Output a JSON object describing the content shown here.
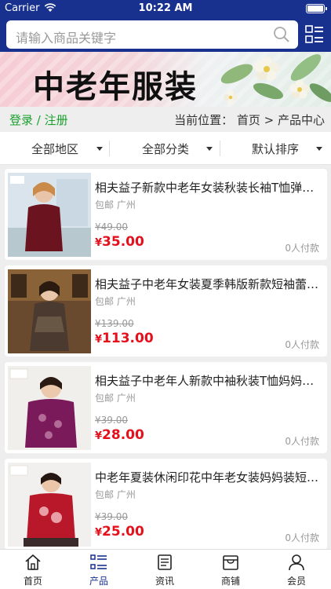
{
  "status_bar": {
    "carrier": "Carrier",
    "time": "10:22 AM"
  },
  "search": {
    "placeholder": "请输入商品关键字"
  },
  "banner": {
    "title": "中老年服装"
  },
  "crumbbar": {
    "login": "登录 / 注册",
    "location": "当前位置： 首页 > 产品中心"
  },
  "filters": [
    {
      "label": "全部地区"
    },
    {
      "label": "全部分类"
    },
    {
      "label": "默认排序"
    }
  ],
  "products": [
    {
      "title": "相夫益子新款中老年女装秋装长袖T恤弹力打底衫",
      "meta": "包邮 广州",
      "old_price": "¥49.00",
      "currency": "¥",
      "price": "35.00",
      "paid": "0人付款",
      "shirt_color": "#6b1420"
    },
    {
      "title": "相夫益子中老年女装夏季韩版新款短袖蕾丝连衣裙",
      "meta": "包邮 广州",
      "old_price": "¥139.00",
      "currency": "¥",
      "price": "113.00",
      "paid": "0人付款",
      "shirt_color": "#4a3a30"
    },
    {
      "title": "相夫益子中老年人新款中袖秋装T恤妈妈装上衣",
      "meta": "包邮 广州",
      "old_price": "¥39.00",
      "currency": "¥",
      "price": "28.00",
      "paid": "0人付款",
      "shirt_color": "#7a1a5a"
    },
    {
      "title": "中老年夏装休闲印花中年老女装妈妈装短袖T恤",
      "meta": "包邮 广州",
      "old_price": "¥39.00",
      "currency": "¥",
      "price": "25.00",
      "paid": "0人付款",
      "shirt_color": "#b8182a"
    }
  ],
  "tabs": [
    {
      "label": "首页",
      "icon": "home-icon"
    },
    {
      "label": "产品",
      "icon": "list-icon",
      "active": true
    },
    {
      "label": "资讯",
      "icon": "news-icon"
    },
    {
      "label": "商铺",
      "icon": "shop-icon"
    },
    {
      "label": "会员",
      "icon": "user-icon"
    }
  ],
  "colors": {
    "brand": "#18318f",
    "price": "#e4101b",
    "login": "#1aa12f"
  }
}
